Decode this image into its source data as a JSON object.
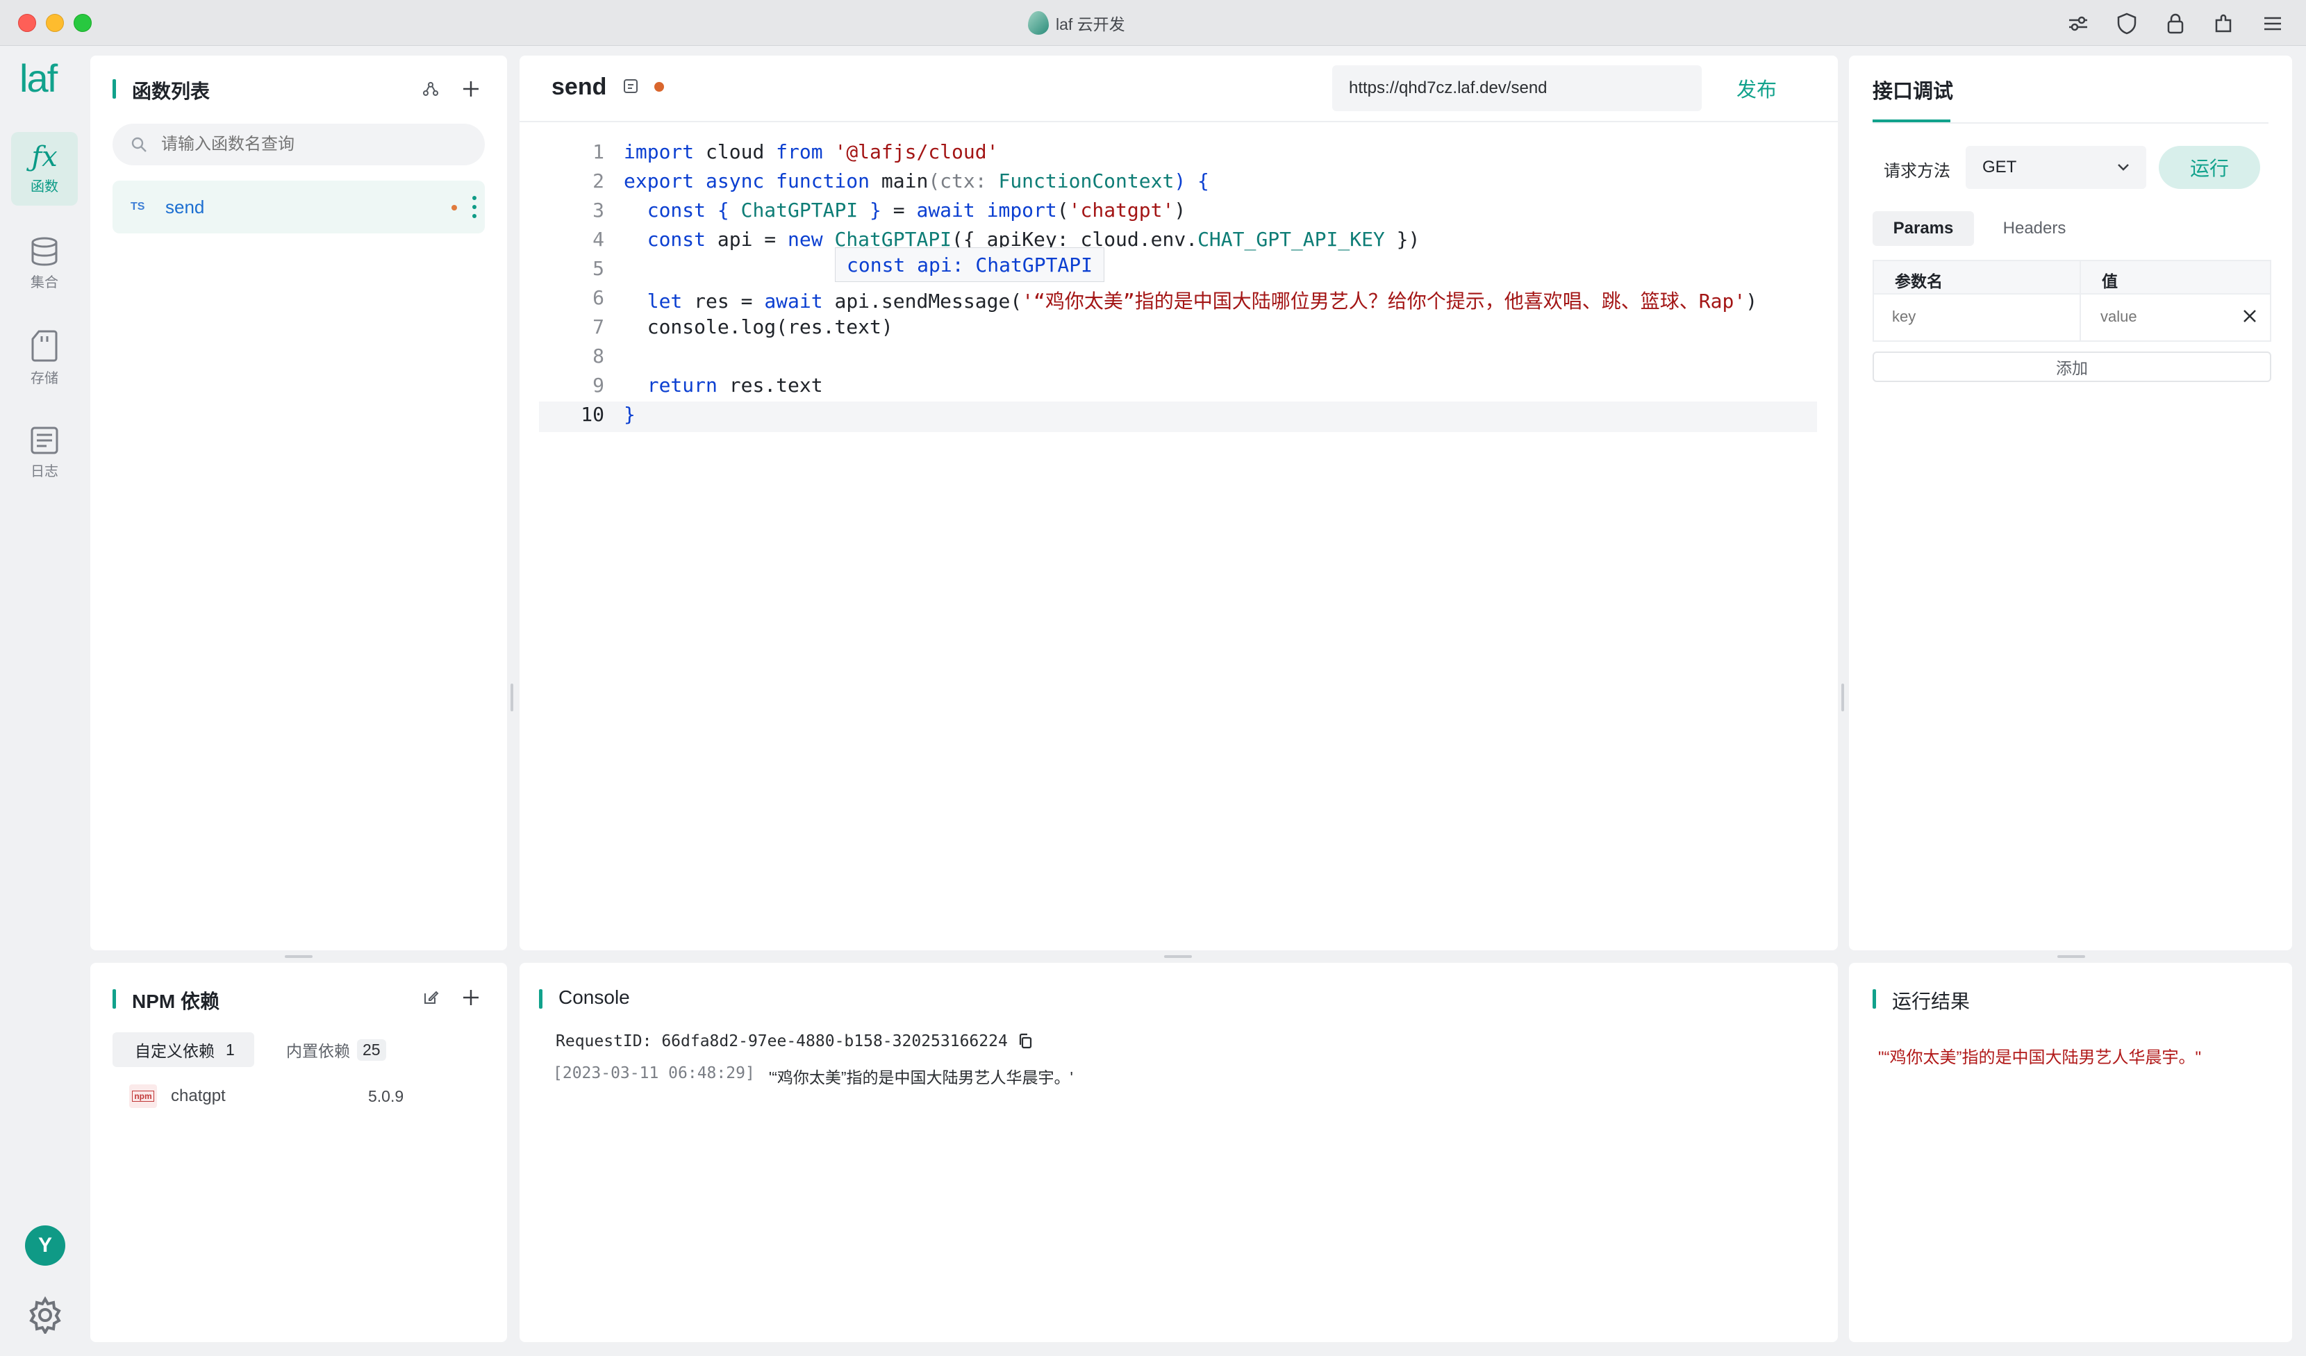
{
  "window": {
    "title": "laf 云开发"
  },
  "nav": {
    "logo": "laf",
    "items": [
      {
        "label": "函数",
        "icon": "function-icon"
      },
      {
        "label": "集合",
        "icon": "database-icon"
      },
      {
        "label": "存储",
        "icon": "storage-icon"
      },
      {
        "label": "日志",
        "icon": "log-icon"
      }
    ],
    "avatar": "Y"
  },
  "function_list": {
    "title": "函数列表",
    "search_placeholder": "请输入函数名查询",
    "items": [
      {
        "lang": "TS",
        "name": "send"
      }
    ]
  },
  "editor": {
    "function_name": "send",
    "url": "https://qhd7cz.laf.dev/send",
    "publish_label": "发布",
    "line_numbers": [
      "1",
      "2",
      "3",
      "4",
      "5",
      "6",
      "7",
      "8",
      "9",
      "10"
    ],
    "hover_tooltip": "const api: ChatGPTAPI"
  },
  "debug": {
    "title": "接口调试",
    "method_label": "请求方法",
    "method_value": "GET",
    "run_label": "运行",
    "tabs": [
      "Params",
      "Headers"
    ],
    "table_headers": [
      "参数名",
      "值"
    ],
    "key_placeholder": "key",
    "value_placeholder": "value",
    "add_label": "添加"
  },
  "npm": {
    "title": "NPM 依赖",
    "tabs": [
      {
        "label": "自定义依赖",
        "count": "1"
      },
      {
        "label": "内置依赖",
        "count": "25"
      }
    ],
    "packages": [
      {
        "badge": "npm",
        "name": "chatgpt",
        "version": "5.0.9"
      }
    ]
  },
  "console": {
    "title": "Console",
    "request_id": "RequestID: 66dfa8d2-97ee-4880-b158-320253166224",
    "log_time": "[2023-03-11 06:48:29]",
    "log_text": "'“鸡你太美”指的是中国大陆男艺人华晨宇。'"
  },
  "result": {
    "title": "运行结果",
    "text": "\"“鸡你太美”指的是中国大陆男艺人华晨宇。\""
  },
  "colors": {
    "accent": "#11a28c",
    "string": "#a31515",
    "keyword": "#0b3fd1",
    "type": "#0e7d76"
  }
}
